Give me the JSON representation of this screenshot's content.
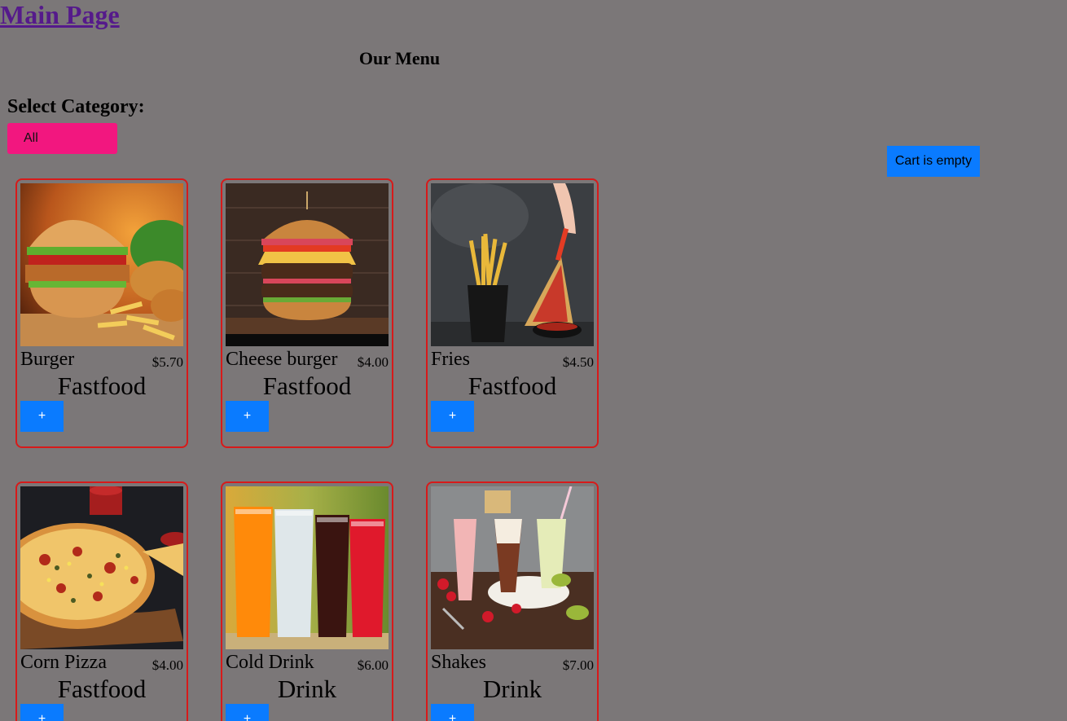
{
  "header": {
    "main_link": "Main Page",
    "menu_title": "Our Menu",
    "category_label": "Select Category:",
    "category_selected": "All"
  },
  "cart": {
    "status": "Cart is empty"
  },
  "products": [
    {
      "name": "Burger",
      "price": "$5.70",
      "category": "Fastfood",
      "add_label": "+",
      "image": "burger-photo"
    },
    {
      "name": "Cheese burger",
      "price": "$4.00",
      "category": "Fastfood",
      "add_label": "+",
      "image": "cheese-burger-photo"
    },
    {
      "name": "Fries",
      "price": "$4.50",
      "category": "Fastfood",
      "add_label": "+",
      "image": "fries-photo"
    },
    {
      "name": "Corn Pizza",
      "price": "$4.00",
      "category": "Fastfood",
      "add_label": "+",
      "image": "pizza-photo"
    },
    {
      "name": "Cold Drink",
      "price": "$6.00",
      "category": "Drink",
      "add_label": "+",
      "image": "cold-drink-photo"
    },
    {
      "name": "Shakes",
      "price": "$7.00",
      "category": "Drink",
      "add_label": "+",
      "image": "shakes-photo"
    }
  ]
}
